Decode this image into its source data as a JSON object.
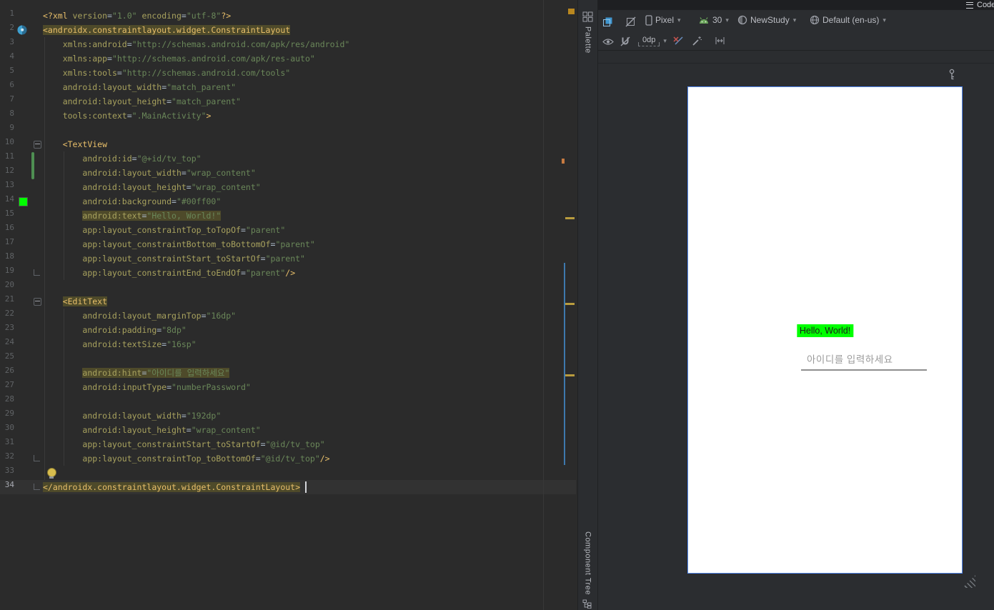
{
  "chrome": {
    "editor_mode_label": "Code"
  },
  "editor": {
    "current_line": 34,
    "lines": [
      [
        [
          "<?xml ",
          "t"
        ],
        [
          "version",
          "a"
        ],
        [
          "=",
          "p"
        ],
        [
          "\"1.0\"",
          "s"
        ],
        [
          " ",
          "p"
        ],
        [
          "encoding",
          "a"
        ],
        [
          "=",
          "p"
        ],
        [
          "\"utf-8\"",
          "s"
        ],
        [
          "?>",
          "t"
        ]
      ],
      [
        [
          "<androidx.constraintlayout.widget.ConstraintLayout",
          "t",
          1
        ]
      ],
      [
        [
          "    ",
          "p"
        ],
        [
          "xmlns:android",
          "a"
        ],
        [
          "=",
          "p"
        ],
        [
          "\"http://schemas.android.com/apk/res/android\"",
          "s"
        ]
      ],
      [
        [
          "    ",
          "p"
        ],
        [
          "xmlns:app",
          "a"
        ],
        [
          "=",
          "p"
        ],
        [
          "\"http://schemas.android.com/apk/res-auto\"",
          "s"
        ]
      ],
      [
        [
          "    ",
          "p"
        ],
        [
          "xmlns:tools",
          "a"
        ],
        [
          "=",
          "p"
        ],
        [
          "\"http://schemas.android.com/tools\"",
          "s"
        ]
      ],
      [
        [
          "    ",
          "p"
        ],
        [
          "android:layout_width",
          "a"
        ],
        [
          "=",
          "p"
        ],
        [
          "\"match_parent\"",
          "s"
        ]
      ],
      [
        [
          "    ",
          "p"
        ],
        [
          "android:layout_height",
          "a"
        ],
        [
          "=",
          "p"
        ],
        [
          "\"match_parent\"",
          "s"
        ]
      ],
      [
        [
          "    ",
          "p"
        ],
        [
          "tools:context",
          "a"
        ],
        [
          "=",
          "p"
        ],
        [
          "\".MainActivity\"",
          "s"
        ],
        [
          ">",
          "t"
        ]
      ],
      [],
      [
        [
          "    ",
          "p"
        ],
        [
          "<TextView",
          "t"
        ]
      ],
      [
        [
          "        ",
          "p"
        ],
        [
          "android:id",
          "a"
        ],
        [
          "=",
          "p"
        ],
        [
          "\"@+id/tv_top\"",
          "s"
        ]
      ],
      [
        [
          "        ",
          "p"
        ],
        [
          "android:layout_width",
          "a"
        ],
        [
          "=",
          "p"
        ],
        [
          "\"wrap_content\"",
          "s"
        ]
      ],
      [
        [
          "        ",
          "p"
        ],
        [
          "android:layout_height",
          "a"
        ],
        [
          "=",
          "p"
        ],
        [
          "\"wrap_content\"",
          "s"
        ]
      ],
      [
        [
          "        ",
          "p"
        ],
        [
          "android:background",
          "a"
        ],
        [
          "=",
          "p"
        ],
        [
          "\"#00ff00\"",
          "s"
        ]
      ],
      [
        [
          "        ",
          "p"
        ],
        [
          "android:text",
          "a",
          1
        ],
        [
          "=",
          "p",
          1
        ],
        [
          "\"Hello, World!\"",
          "s",
          1
        ]
      ],
      [
        [
          "        ",
          "p"
        ],
        [
          "app:layout_constraintTop_toTopOf",
          "a"
        ],
        [
          "=",
          "p"
        ],
        [
          "\"parent\"",
          "s"
        ]
      ],
      [
        [
          "        ",
          "p"
        ],
        [
          "app:layout_constraintBottom_toBottomOf",
          "a"
        ],
        [
          "=",
          "p"
        ],
        [
          "\"parent\"",
          "s"
        ]
      ],
      [
        [
          "        ",
          "p"
        ],
        [
          "app:layout_constraintStart_toStartOf",
          "a"
        ],
        [
          "=",
          "p"
        ],
        [
          "\"parent\"",
          "s"
        ]
      ],
      [
        [
          "        ",
          "p"
        ],
        [
          "app:layout_constraintEnd_toEndOf",
          "a"
        ],
        [
          "=",
          "p"
        ],
        [
          "\"parent\"",
          "s"
        ],
        [
          "/>",
          "t"
        ]
      ],
      [],
      [
        [
          "    ",
          "p"
        ],
        [
          "<EditText",
          "t",
          1
        ]
      ],
      [
        [
          "        ",
          "p"
        ],
        [
          "android:layout_marginTop",
          "a"
        ],
        [
          "=",
          "p"
        ],
        [
          "\"16dp\"",
          "s"
        ]
      ],
      [
        [
          "        ",
          "p"
        ],
        [
          "android:padding",
          "a"
        ],
        [
          "=",
          "p"
        ],
        [
          "\"8dp\"",
          "s"
        ]
      ],
      [
        [
          "        ",
          "p"
        ],
        [
          "android:textSize",
          "a"
        ],
        [
          "=",
          "p"
        ],
        [
          "\"16sp\"",
          "s"
        ]
      ],
      [],
      [
        [
          "        ",
          "p"
        ],
        [
          "android:hint",
          "a",
          1
        ],
        [
          "=",
          "p",
          1
        ],
        [
          "\"아이디를 입력하세요\"",
          "s",
          1
        ]
      ],
      [
        [
          "        ",
          "p"
        ],
        [
          "android:inputType",
          "a"
        ],
        [
          "=",
          "p"
        ],
        [
          "\"numberPassword\"",
          "s"
        ]
      ],
      [],
      [
        [
          "        ",
          "p"
        ],
        [
          "android:layout_width",
          "a"
        ],
        [
          "=",
          "p"
        ],
        [
          "\"192dp\"",
          "s"
        ]
      ],
      [
        [
          "        ",
          "p"
        ],
        [
          "android:layout_height",
          "a"
        ],
        [
          "=",
          "p"
        ],
        [
          "\"wrap_content\"",
          "s"
        ]
      ],
      [
        [
          "        ",
          "p"
        ],
        [
          "app:layout_constraintStart_toStartOf",
          "a"
        ],
        [
          "=",
          "p"
        ],
        [
          "\"@id/tv_top\"",
          "s"
        ]
      ],
      [
        [
          "        ",
          "p"
        ],
        [
          "app:layout_constraintTop_toBottomOf",
          "a"
        ],
        [
          "=",
          "p"
        ],
        [
          "\"@id/tv_top\"",
          "s"
        ],
        [
          "/>",
          "t"
        ]
      ],
      [],
      [
        [
          "</androidx.constraintlayout.widget.ConstraintLayout>",
          "t",
          1
        ]
      ]
    ],
    "gutter": {
      "android_icon_line": 2,
      "color_swatch_line": 14,
      "color_swatch_color": "#00ff00",
      "vcs_change_start_line": 11,
      "vcs_change_end_line": 12,
      "fold_start_lines": [
        10,
        21
      ],
      "fold_end_lines": [
        19,
        32,
        34
      ],
      "lightbulb_line": 33
    },
    "stripe_occurrence_lines": [
      15,
      21,
      26
    ]
  },
  "tool_windows": {
    "palette_label": "Palette",
    "component_tree_label": "Component Tree"
  },
  "design": {
    "toolbar": {
      "device_label": "Pixel",
      "api_label": "30",
      "theme_label": "NewStudy",
      "locale_label": "Default (en-us)",
      "default_margin_label": "0dp"
    },
    "preview": {
      "hello_text": "Hello, World!",
      "hello_bg_color": "#00ff00",
      "hello_text_color": "#1b1b1b",
      "edittext_hint": "아이디를 입력하세요"
    }
  },
  "colors": {
    "xml_tag": "#e8bf6a",
    "xml_attribute": "#a8a25e",
    "xml_string": "#6a8759",
    "occurrence_highlight": "#4e4a2a",
    "canvas_selection_border": "#548af7",
    "vcs_change": "#4e8f52"
  }
}
